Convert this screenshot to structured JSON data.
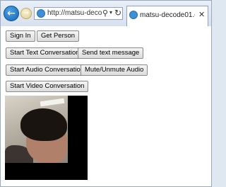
{
  "browser": {
    "address_url": "http://matsu-deco…",
    "tab_title": "matsu-decode01.ex…",
    "back_glyph": "←",
    "forward_glyph": "→",
    "search_glyph": "⚲",
    "dropdown_glyph": "▾",
    "refresh_glyph": "↻",
    "close_glyph": "✕"
  },
  "buttons": {
    "sign_in": "Sign In",
    "get_person": "Get Person",
    "start_text": "Start Text Conversation",
    "send_text": "Send text message",
    "start_audio": "Start Audio Conversation",
    "mute_audio": "Mute/Unmute Audio",
    "start_video": "Start Video Conversation"
  }
}
